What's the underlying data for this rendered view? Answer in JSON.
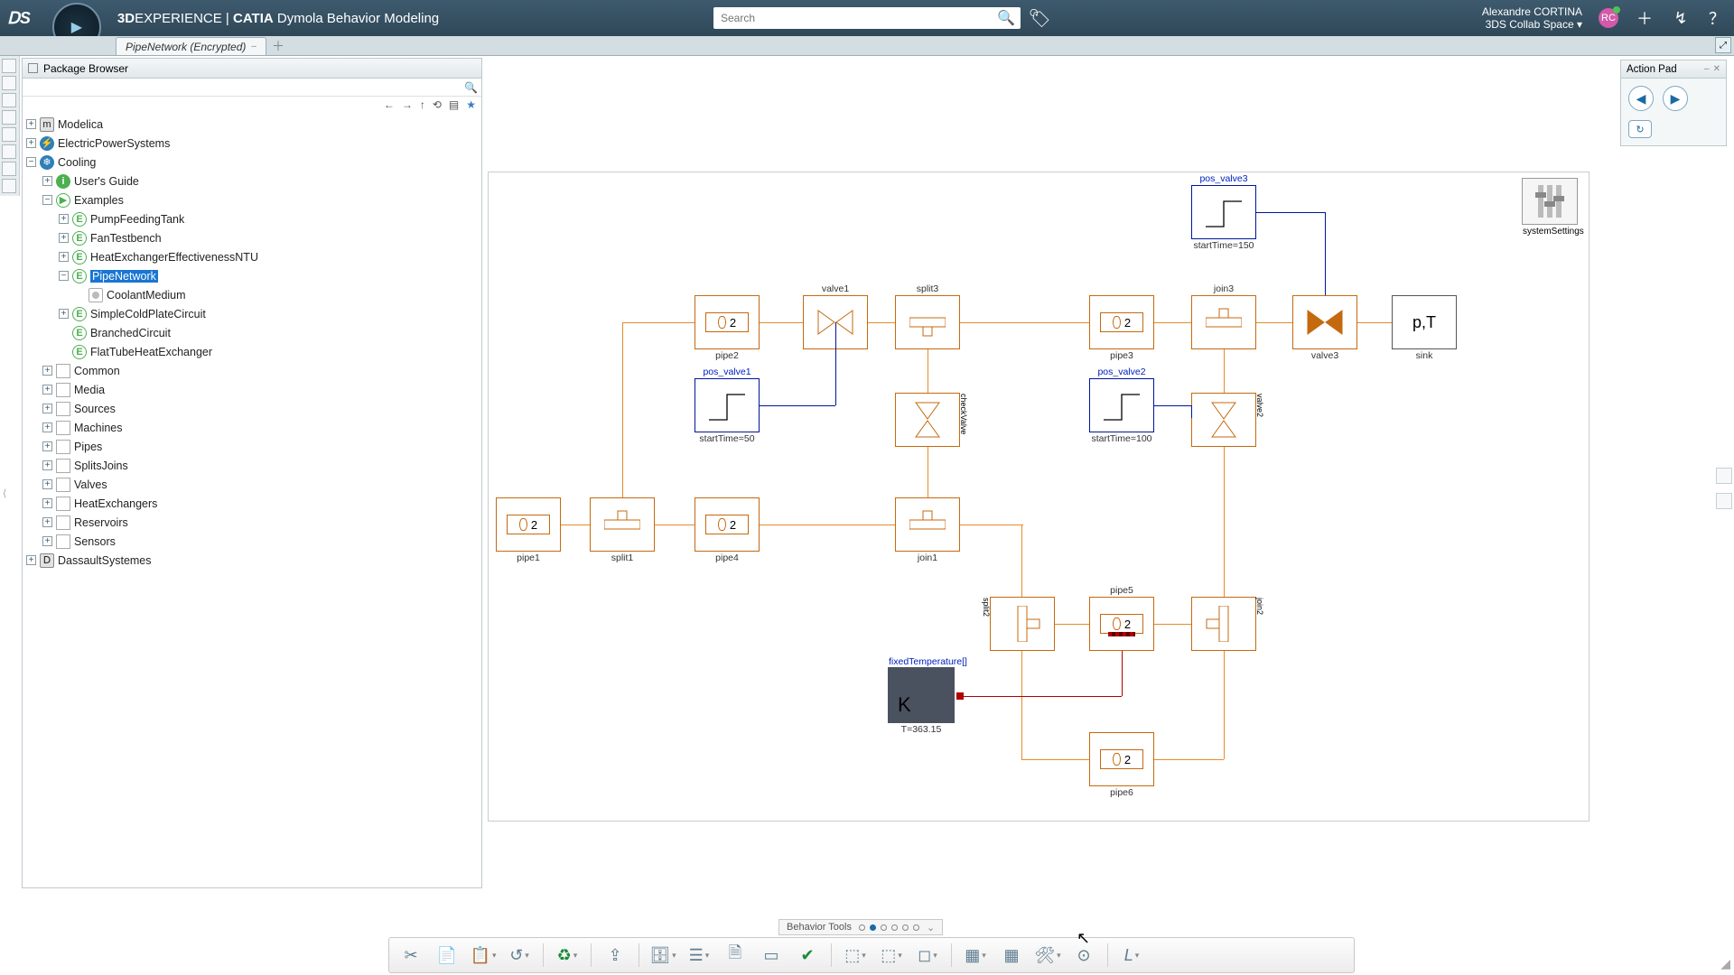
{
  "app": {
    "logo": "3D",
    "brand_bold": "3D",
    "brand_rest": "EXPERIENCE",
    "brand_sep": " | ",
    "brand_app_bold": "CATIA",
    "brand_app_rest": " Dymola Behavior Modeling"
  },
  "search": {
    "placeholder": "Search"
  },
  "user": {
    "name": "Alexandre CORTINA",
    "space": "3DS Collab Space ▾",
    "initials": "RC"
  },
  "tab": {
    "label": "PipeNetwork (Encrypted)"
  },
  "panel": {
    "title": "Package Browser"
  },
  "tree": {
    "modelica": "Modelica",
    "eps": "ElectricPowerSystems",
    "cooling": "Cooling",
    "ug": "User's Guide",
    "examples": "Examples",
    "pft": "PumpFeedingTank",
    "ftb": "FanTestbench",
    "hentu": "HeatExchangerEffectivenessNTU",
    "pipenet": "PipeNetwork",
    "coolmed": "CoolantMedium",
    "scp": "SimpleColdPlateCircuit",
    "bc": "BranchedCircuit",
    "fthe": "FlatTubeHeatExchanger",
    "common": "Common",
    "media": "Media",
    "sources": "Sources",
    "machines": "Machines",
    "pipes": "Pipes",
    "sj": "SplitsJoins",
    "valves": "Valves",
    "he": "HeatExchangers",
    "res": "Reservoirs",
    "sensors": "Sensors",
    "ds": "DassaultSystemes"
  },
  "diagram": {
    "pipe1": {
      "n": "2",
      "label": "pipe1"
    },
    "split1": {
      "label": "split1"
    },
    "pipe4": {
      "n": "2",
      "label": "pipe4"
    },
    "pipe2": {
      "n": "2",
      "label": "pipe2"
    },
    "valve1": {
      "label": "valve1"
    },
    "posv1": {
      "label": "pos_valve1",
      "sub": "startTime=50"
    },
    "split3": {
      "label": "split3"
    },
    "checkv": {
      "label": "checkValve"
    },
    "join1": {
      "label": "join1"
    },
    "split2": {
      "label": "split2"
    },
    "pipe5": {
      "n": "2",
      "label": "pipe5"
    },
    "join2": {
      "label": "join2"
    },
    "pipe6": {
      "n": "2",
      "label": "pipe6"
    },
    "pipe3": {
      "n": "2",
      "label": "pipe3"
    },
    "posv2": {
      "label": "pos_valve2",
      "sub": "startTime=100"
    },
    "valve2": {
      "label": "valve2"
    },
    "join3": {
      "label": "join3"
    },
    "posv3": {
      "label": "pos_valve3",
      "sub": "startTime=150"
    },
    "valve3": {
      "label": "valve3"
    },
    "sink": {
      "text": "p,T",
      "label": "sink"
    },
    "fixedT": {
      "label": "fixedTemperature[]",
      "K": "K",
      "sub": "T=363.15"
    },
    "sysset": {
      "label": "systemSettings"
    }
  },
  "actionpad": {
    "title": "Action Pad"
  },
  "toolbar": {
    "label": "Behavior Tools"
  }
}
